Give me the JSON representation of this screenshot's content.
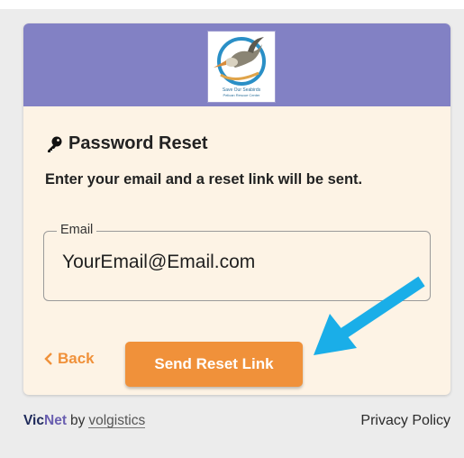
{
  "header": {
    "logo_text_line1": "Save Our Seabirds",
    "logo_text_line2": "Pelican Rescue Center",
    "logo_icon": "pelican-logo"
  },
  "form": {
    "title": "Password Reset",
    "title_icon": "key-icon",
    "instruction": "Enter your email and a reset link will be sent.",
    "email_label": "Email",
    "email_value": "YourEmail@Email.com"
  },
  "actions": {
    "back_label": "Back",
    "back_icon": "chevron-left-icon",
    "send_label": "Send Reset Link"
  },
  "footer": {
    "brand_vic": "Vic",
    "brand_net": "Net",
    "brand_by": "by",
    "brand_volgistics": "volgistics",
    "privacy_label": "Privacy Policy"
  },
  "annotation": {
    "arrow_icon": "pointer-arrow-icon"
  },
  "colors": {
    "header_bg": "#8281c4",
    "card_bg": "#fdf3e5",
    "accent_orange": "#f0913a",
    "arrow_blue": "#1aaee8",
    "page_bg": "#ececec"
  }
}
